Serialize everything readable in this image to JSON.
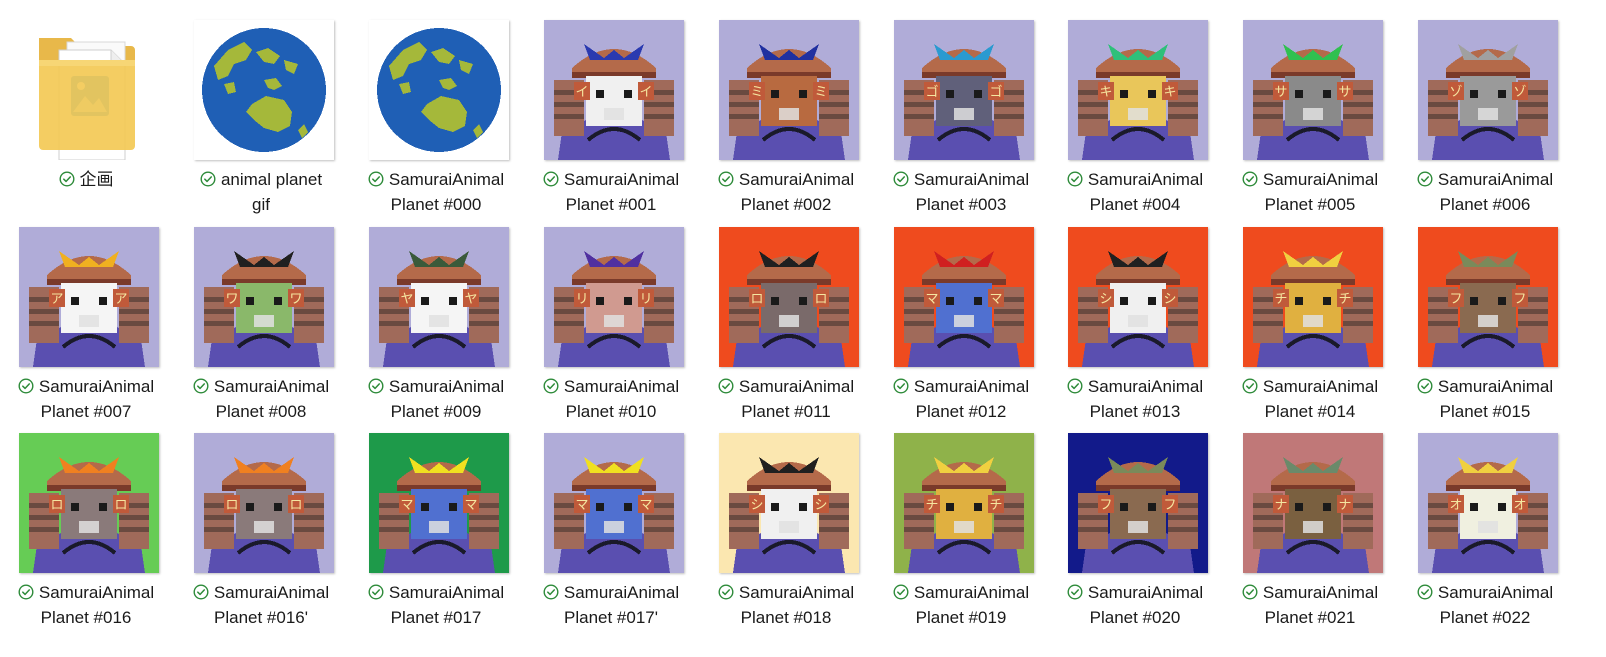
{
  "status_icon": "synced-check-icon",
  "colors": {
    "check": "#2e8b3a",
    "lavender": "#b0acd8",
    "orange_red": "#ef4b1e",
    "green": "#66cc55",
    "dark_green": "#1e9a4a",
    "cream": "#fbe7b0",
    "olive_green": "#8fb24a",
    "navy": "#121a8a",
    "dusty_rose": "#c07878",
    "ocean": "#1f5fb5",
    "land": "#a5b83a"
  },
  "items": [
    {
      "type": "folder",
      "line1": "企画",
      "line2": "",
      "icon": "folder-image-icon"
    },
    {
      "type": "planet",
      "line1": "animal planet",
      "line2": "gif",
      "icon": "planet-globe-icon"
    },
    {
      "type": "planet",
      "line1": "SamuraiAnimal",
      "line2": "Planet #000",
      "icon": "planet-globe-icon"
    },
    {
      "type": "art",
      "line1": "SamuraiAnimal",
      "line2": "Planet #001",
      "bg": "#b0acd8",
      "face": "#f0f0f0",
      "accent": "#2a3ab0",
      "kana": "イ"
    },
    {
      "type": "art",
      "line1": "SamuraiAnimal",
      "line2": "Planet #002",
      "bg": "#b0acd8",
      "face": "#b86a40",
      "accent": "#2030a0",
      "kana": "ミ"
    },
    {
      "type": "art",
      "line1": "SamuraiAnimal",
      "line2": "Planet #003",
      "bg": "#b0acd8",
      "face": "#60607a",
      "accent": "#2a9ad0",
      "kana": "ゴ"
    },
    {
      "type": "art",
      "line1": "SamuraiAnimal",
      "line2": "Planet #004",
      "bg": "#b0acd8",
      "face": "#e9c65a",
      "accent": "#2ec07a",
      "kana": "キ"
    },
    {
      "type": "art",
      "line1": "SamuraiAnimal",
      "line2": "Planet #005",
      "bg": "#b0acd8",
      "face": "#8a8a8a",
      "accent": "#30c050",
      "kana": "サ"
    },
    {
      "type": "art",
      "line1": "SamuraiAnimal",
      "line2": "Planet #006",
      "bg": "#b0acd8",
      "face": "#9a9a9a",
      "accent": "#a0a0a0",
      "kana": "ゾ"
    },
    {
      "type": "art",
      "line1": "SamuraiAnimal",
      "line2": "Planet #007",
      "bg": "#b0acd8",
      "face": "#f5f5f5",
      "accent": "#f0b020",
      "kana": "ア"
    },
    {
      "type": "art",
      "line1": "SamuraiAnimal",
      "line2": "Planet #008",
      "bg": "#b0acd8",
      "face": "#8ab86a",
      "accent": "#202020",
      "kana": "ワ"
    },
    {
      "type": "art",
      "line1": "SamuraiAnimal",
      "line2": "Planet #009",
      "bg": "#b0acd8",
      "face": "#f5f5f5",
      "accent": "#3a5a3a",
      "kana": "ヤ"
    },
    {
      "type": "art",
      "line1": "SamuraiAnimal",
      "line2": "Planet #010",
      "bg": "#b0acd8",
      "face": "#d09a90",
      "accent": "#5030a0",
      "kana": "リ"
    },
    {
      "type": "art",
      "line1": "SamuraiAnimal",
      "line2": "Planet #011",
      "bg": "#ef4b1e",
      "face": "#7a6a6a",
      "accent": "#202020",
      "kana": "ロ"
    },
    {
      "type": "art",
      "line1": "SamuraiAnimal",
      "line2": "Planet #012",
      "bg": "#ef4b1e",
      "face": "#5070d0",
      "accent": "#d02020",
      "kana": "マ"
    },
    {
      "type": "art",
      "line1": "SamuraiAnimal",
      "line2": "Planet #013",
      "bg": "#ef4b1e",
      "face": "#f0f0f0",
      "accent": "#202020",
      "kana": "シ"
    },
    {
      "type": "art",
      "line1": "SamuraiAnimal",
      "line2": "Planet #014",
      "bg": "#ef4b1e",
      "face": "#e0b040",
      "accent": "#f0d040",
      "kana": "チ"
    },
    {
      "type": "art",
      "line1": "SamuraiAnimal",
      "line2": "Planet #015",
      "bg": "#ef4b1e",
      "face": "#8a6a50",
      "accent": "#7a8a5a",
      "kana": "フ"
    },
    {
      "type": "art",
      "line1": "SamuraiAnimal",
      "line2": "Planet #016",
      "bg": "#66cc55",
      "face": "#8a7a7a",
      "accent": "#f08020",
      "kana": "ロ"
    },
    {
      "type": "art",
      "line1": "SamuraiAnimal",
      "line2": "Planet #016'",
      "bg": "#b0acd8",
      "face": "#8a7a7a",
      "accent": "#f08020",
      "kana": "ロ"
    },
    {
      "type": "art",
      "line1": "SamuraiAnimal",
      "line2": "Planet #017",
      "bg": "#1e9a4a",
      "face": "#5070d0",
      "accent": "#f0e020",
      "kana": "マ"
    },
    {
      "type": "art",
      "line1": "SamuraiAnimal",
      "line2": "Planet #017'",
      "bg": "#b0acd8",
      "face": "#5070d0",
      "accent": "#f0e020",
      "kana": "マ"
    },
    {
      "type": "art",
      "line1": "SamuraiAnimal",
      "line2": "Planet #018",
      "bg": "#fbe7b0",
      "face": "#f0f0f0",
      "accent": "#202020",
      "kana": "シ"
    },
    {
      "type": "art",
      "line1": "SamuraiAnimal",
      "line2": "Planet #019",
      "bg": "#8fb24a",
      "face": "#e0b040",
      "accent": "#f0d040",
      "kana": "チ"
    },
    {
      "type": "art",
      "line1": "SamuraiAnimal",
      "line2": "Planet #020",
      "bg": "#121a8a",
      "face": "#8a6a50",
      "accent": "#7a8a5a",
      "kana": "フ"
    },
    {
      "type": "art",
      "line1": "SamuraiAnimal",
      "line2": "Planet #021",
      "bg": "#c07878",
      "face": "#7a6040",
      "accent": "#6a8a6a",
      "kana": "ナ"
    },
    {
      "type": "art",
      "line1": "SamuraiAnimal",
      "line2": "Planet #022",
      "bg": "#b0acd8",
      "face": "#f0f0e0",
      "accent": "#f0d040",
      "kana": "オ"
    }
  ]
}
